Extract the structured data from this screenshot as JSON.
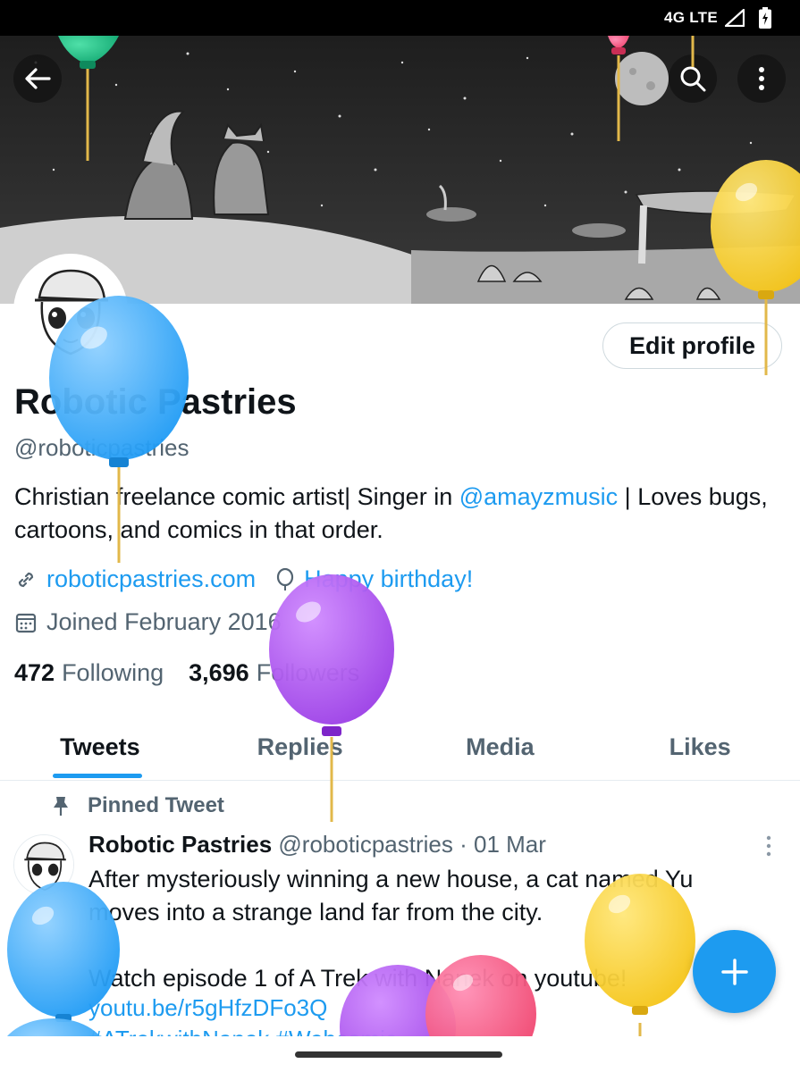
{
  "status_bar": {
    "network": "4G LTE",
    "icons": [
      "signal-icon",
      "battery-charging-icon"
    ]
  },
  "header": {
    "back_icon": "arrow-left-icon",
    "search_icon": "search-icon",
    "more_icon": "more-vertical-icon"
  },
  "profile": {
    "display_name": "Robotic Pastries",
    "handle": "@roboticpastries",
    "edit_button": "Edit profile",
    "bio_part1": "Christian freelance comic artist| Singer in ",
    "bio_mention": "@amayzmusic",
    "bio_part2": " | Loves bugs, cartoons, and comics in that order.",
    "website": "roboticpastries.com",
    "birthday": "Happy birthday!",
    "joined": "Joined February 2016",
    "following_count": "472",
    "following_label": "Following",
    "followers_count": "3,696",
    "followers_label": "Followers"
  },
  "tabs": [
    {
      "label": "Tweets",
      "active": true
    },
    {
      "label": "Replies",
      "active": false
    },
    {
      "label": "Media",
      "active": false
    },
    {
      "label": "Likes",
      "active": false
    }
  ],
  "pinned_tweet": {
    "pinned_label": "Pinned Tweet",
    "author_name": "Robotic Pastries",
    "author_handle": "@roboticpastries",
    "date": "· 01 Mar",
    "text_line1": "After mysteriously winning a new house, a cat named Yu moves into a strange land far from the city.",
    "text_line2": "Watch episode 1 of A Trek with Nanek on youtube!",
    "link": "youtu.be/r5gHfzDFo3Q",
    "hashtags": "#ATrekwithNanek #Webcomic"
  },
  "colors": {
    "accent": "#1d9bf0",
    "text": "#0f1419",
    "muted": "#536471",
    "border": "#cfd9de"
  }
}
